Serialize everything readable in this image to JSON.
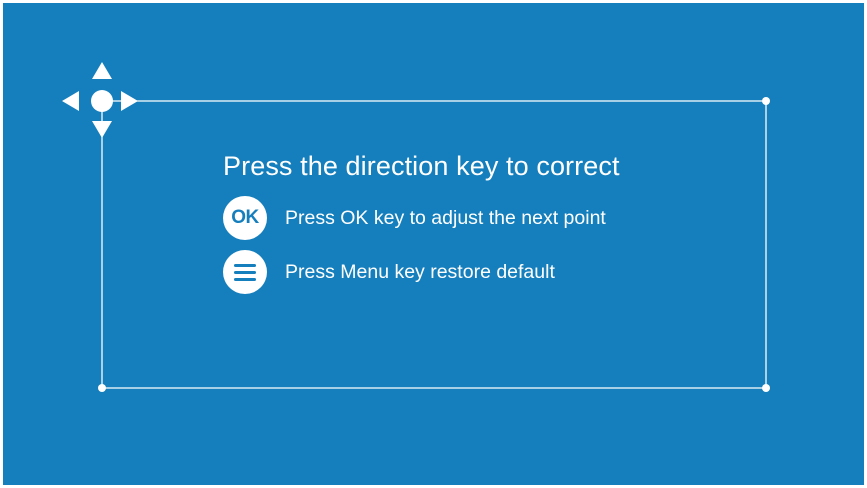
{
  "colors": {
    "background": "#157fbd",
    "foreground": "#ffffff"
  },
  "title": "Press the direction key to correct",
  "instructions": [
    {
      "icon": "ok-key-icon",
      "badge_text": "OK",
      "text": "Press OK key to adjust the next point"
    },
    {
      "icon": "menu-key-icon",
      "text": "Press Menu key restore default"
    }
  ],
  "direction_pad": {
    "icon": "direction-pad-icon"
  }
}
